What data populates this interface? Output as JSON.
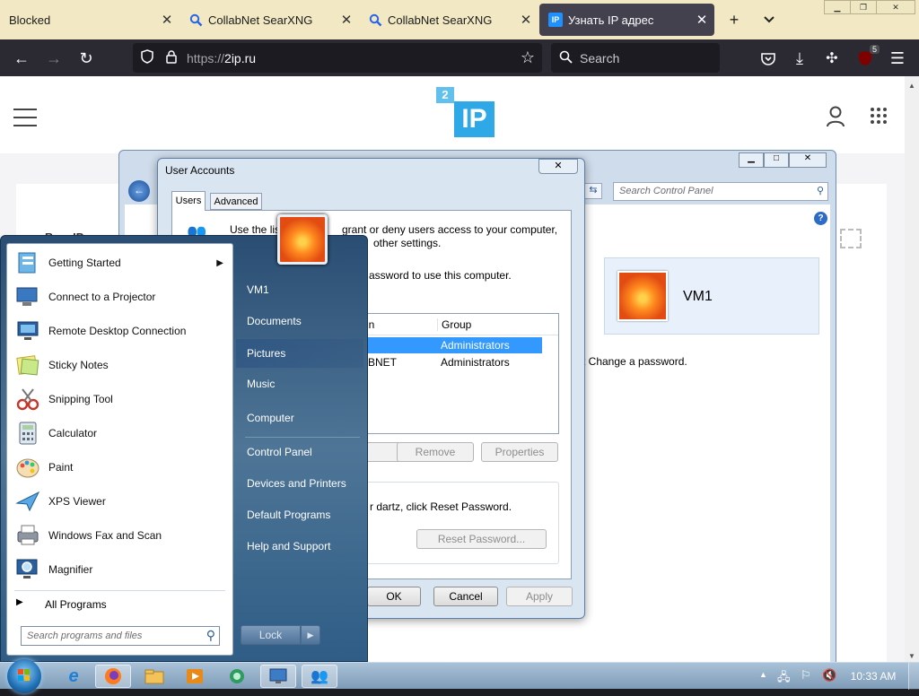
{
  "browser": {
    "tabs": [
      {
        "label": "Blocked",
        "active": false
      },
      {
        "label": "CollabNet SearXNG",
        "active": false
      },
      {
        "label": "CollabNet SearXNG",
        "active": false
      },
      {
        "label": "Узнать IP адрес",
        "active": true
      }
    ],
    "favicon_ip": "IP",
    "url_prefix": "https://",
    "url_host": "2ip.ru",
    "search_placeholder": "Search",
    "extension_badge": "5"
  },
  "site": {
    "logo_top": "2",
    "logo_main": "IP",
    "bg_text": "Ваш IP адрес"
  },
  "control_panel": {
    "search_placeholder": "Search Control Panel",
    "user_name": "VM1",
    "behind_text": "t Change a password."
  },
  "user_accounts": {
    "title": "User Accounts",
    "tabs": [
      "Users",
      "Advanced"
    ],
    "intro": "Use the list below to grant or deny users access to your computer, and to change passwords and other settings.",
    "intro_line1": "Use the list",
    "intro_line1_end": "grant or deny users access to your computer,",
    "intro_line2_end": "other settings.",
    "must_enter": "assword to use this computer.",
    "table_headers": {
      "name": "Domain",
      "group": "Group"
    },
    "rows": [
      {
        "name": "",
        "group": "Administrators",
        "selected": true
      },
      {
        "name": "BNET",
        "group": "Administrators",
        "selected": false
      }
    ],
    "btn_add": "Add...",
    "btn_remove": "Remove",
    "btn_properties": "Properties",
    "reset_text": "r dartz, click Reset Password.",
    "btn_reset": "Reset Password...",
    "btn_ok": "OK",
    "btn_cancel": "Cancel",
    "btn_apply": "Apply"
  },
  "start_menu": {
    "programs": [
      {
        "label": "Getting Started",
        "icon": "getting-started-icon",
        "submenu": true
      },
      {
        "label": "Connect to a Projector",
        "icon": "projector-icon",
        "submenu": false
      },
      {
        "label": "Remote Desktop Connection",
        "icon": "remote-desktop-icon",
        "submenu": false
      },
      {
        "label": "Sticky Notes",
        "icon": "sticky-notes-icon",
        "submenu": false
      },
      {
        "label": "Snipping Tool",
        "icon": "snipping-tool-icon",
        "submenu": false
      },
      {
        "label": "Calculator",
        "icon": "calculator-icon",
        "submenu": false
      },
      {
        "label": "Paint",
        "icon": "paint-icon",
        "submenu": false
      },
      {
        "label": "XPS Viewer",
        "icon": "xps-viewer-icon",
        "submenu": false
      },
      {
        "label": "Windows Fax and Scan",
        "icon": "fax-scan-icon",
        "submenu": false
      },
      {
        "label": "Magnifier",
        "icon": "magnifier-icon",
        "submenu": false
      }
    ],
    "all_programs": "All Programs",
    "search_placeholder": "Search programs and files",
    "right_items": [
      "VM1",
      "Documents",
      "Pictures",
      "Music",
      "Computer",
      "Control Panel",
      "Devices and Printers",
      "Default Programs",
      "Help and Support"
    ],
    "lock_label": "Lock"
  },
  "taskbar": {
    "clock": "10:33 AM"
  }
}
